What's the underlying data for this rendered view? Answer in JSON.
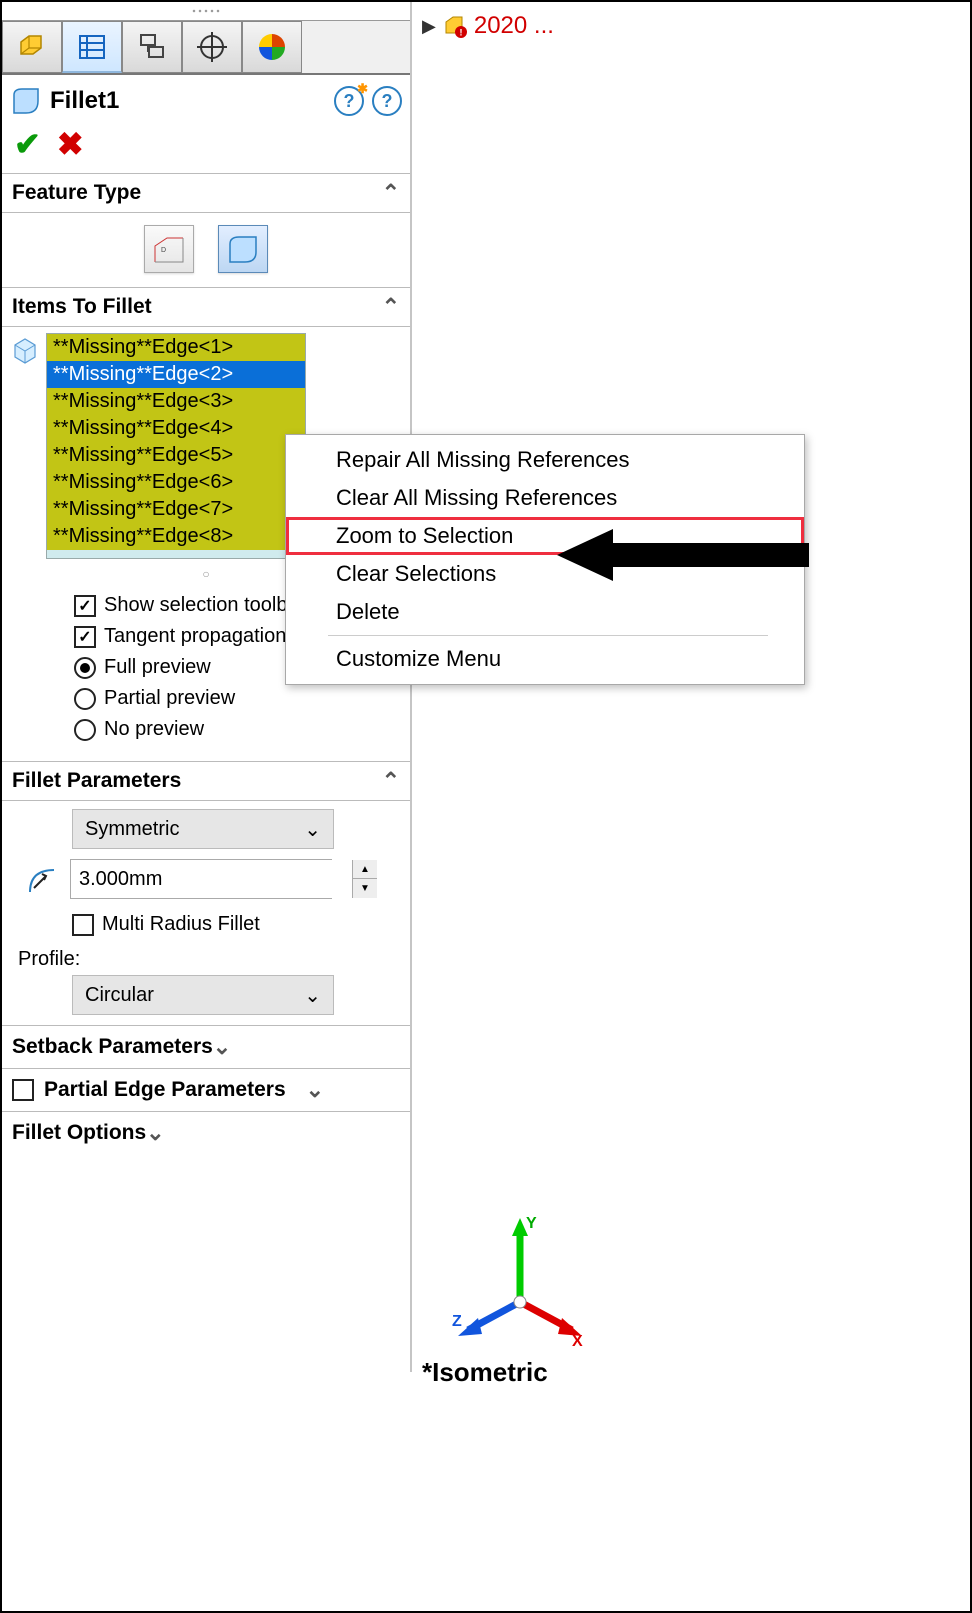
{
  "feature": {
    "title": "Fillet1"
  },
  "sections": {
    "feature_type": "Feature Type",
    "items_to_fillet": "Items To Fillet",
    "fillet_parameters": "Fillet Parameters",
    "setback_parameters": "Setback Parameters",
    "partial_edge_parameters": "Partial Edge Parameters",
    "fillet_options": "Fillet Options"
  },
  "edges": [
    "**Missing**Edge<1>",
    "**Missing**Edge<2>",
    "**Missing**Edge<3>",
    "**Missing**Edge<4>",
    "**Missing**Edge<5>",
    "**Missing**Edge<6>",
    "**Missing**Edge<7>",
    "**Missing**Edge<8>"
  ],
  "options": {
    "show_toolbar": "Show selection toolbar",
    "tangent_prop": "Tangent propagation",
    "full_preview": "Full preview",
    "partial_preview": "Partial preview",
    "no_preview": "No preview"
  },
  "params": {
    "symmetric": "Symmetric",
    "radius": "3.000mm",
    "multi_radius": "Multi Radius Fillet",
    "profile_label": "Profile:",
    "circular": "Circular"
  },
  "context_menu": {
    "repair_all": "Repair All Missing References",
    "clear_all": "Clear All Missing References",
    "zoom_sel": "Zoom to Selection",
    "clear_sel": "Clear Selections",
    "delete": "Delete",
    "customize": "Customize Menu"
  },
  "top_right": {
    "label": "2020 ..."
  },
  "viewport": {
    "orientation": "*Isometric",
    "axes": {
      "x": "X",
      "y": "Y",
      "z": "Z"
    }
  }
}
